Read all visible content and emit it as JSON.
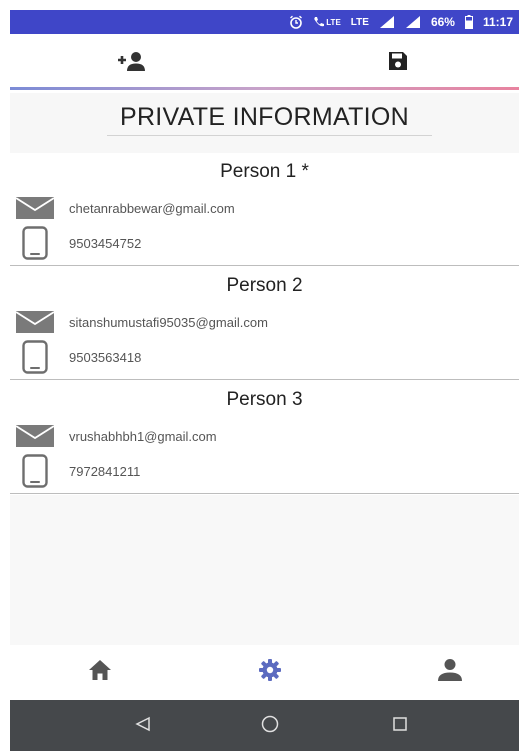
{
  "status_bar": {
    "network_lte_call": "LTE",
    "network_lte": "LTE",
    "battery": "66%",
    "time": "11:17",
    "icons": [
      "alarm-icon",
      "volte-call-icon",
      "signal-icon",
      "signal-icon",
      "battery-icon"
    ]
  },
  "toolbar": {
    "icons": [
      "add-person-icon",
      "save-icon"
    ]
  },
  "page_title": "PRIVATE INFORMATION",
  "persons": [
    {
      "name": "Person 1 *",
      "email": "chetanrabbewar@gmail.com",
      "phone": "9503454752"
    },
    {
      "name": "Person 2",
      "email": "sitanshumustafi95035@gmail.com",
      "phone": "9503563418"
    },
    {
      "name": "Person 3",
      "email": "vrushabhbh1@gmail.com",
      "phone": "7972841211"
    }
  ],
  "bottom_nav": {
    "items": [
      {
        "icon": "home-icon",
        "active": false
      },
      {
        "icon": "settings-icon",
        "active": true
      },
      {
        "icon": "profile-icon",
        "active": false
      }
    ],
    "active_color": "#5c6bc0",
    "inactive_color": "#555555"
  },
  "system_nav": {
    "icons": [
      "back-icon",
      "home-circle-icon",
      "recent-apps-icon"
    ]
  },
  "colors": {
    "status_bar": "#3f46c8",
    "system_nav": "#45484b",
    "icon_gray": "#777777"
  }
}
